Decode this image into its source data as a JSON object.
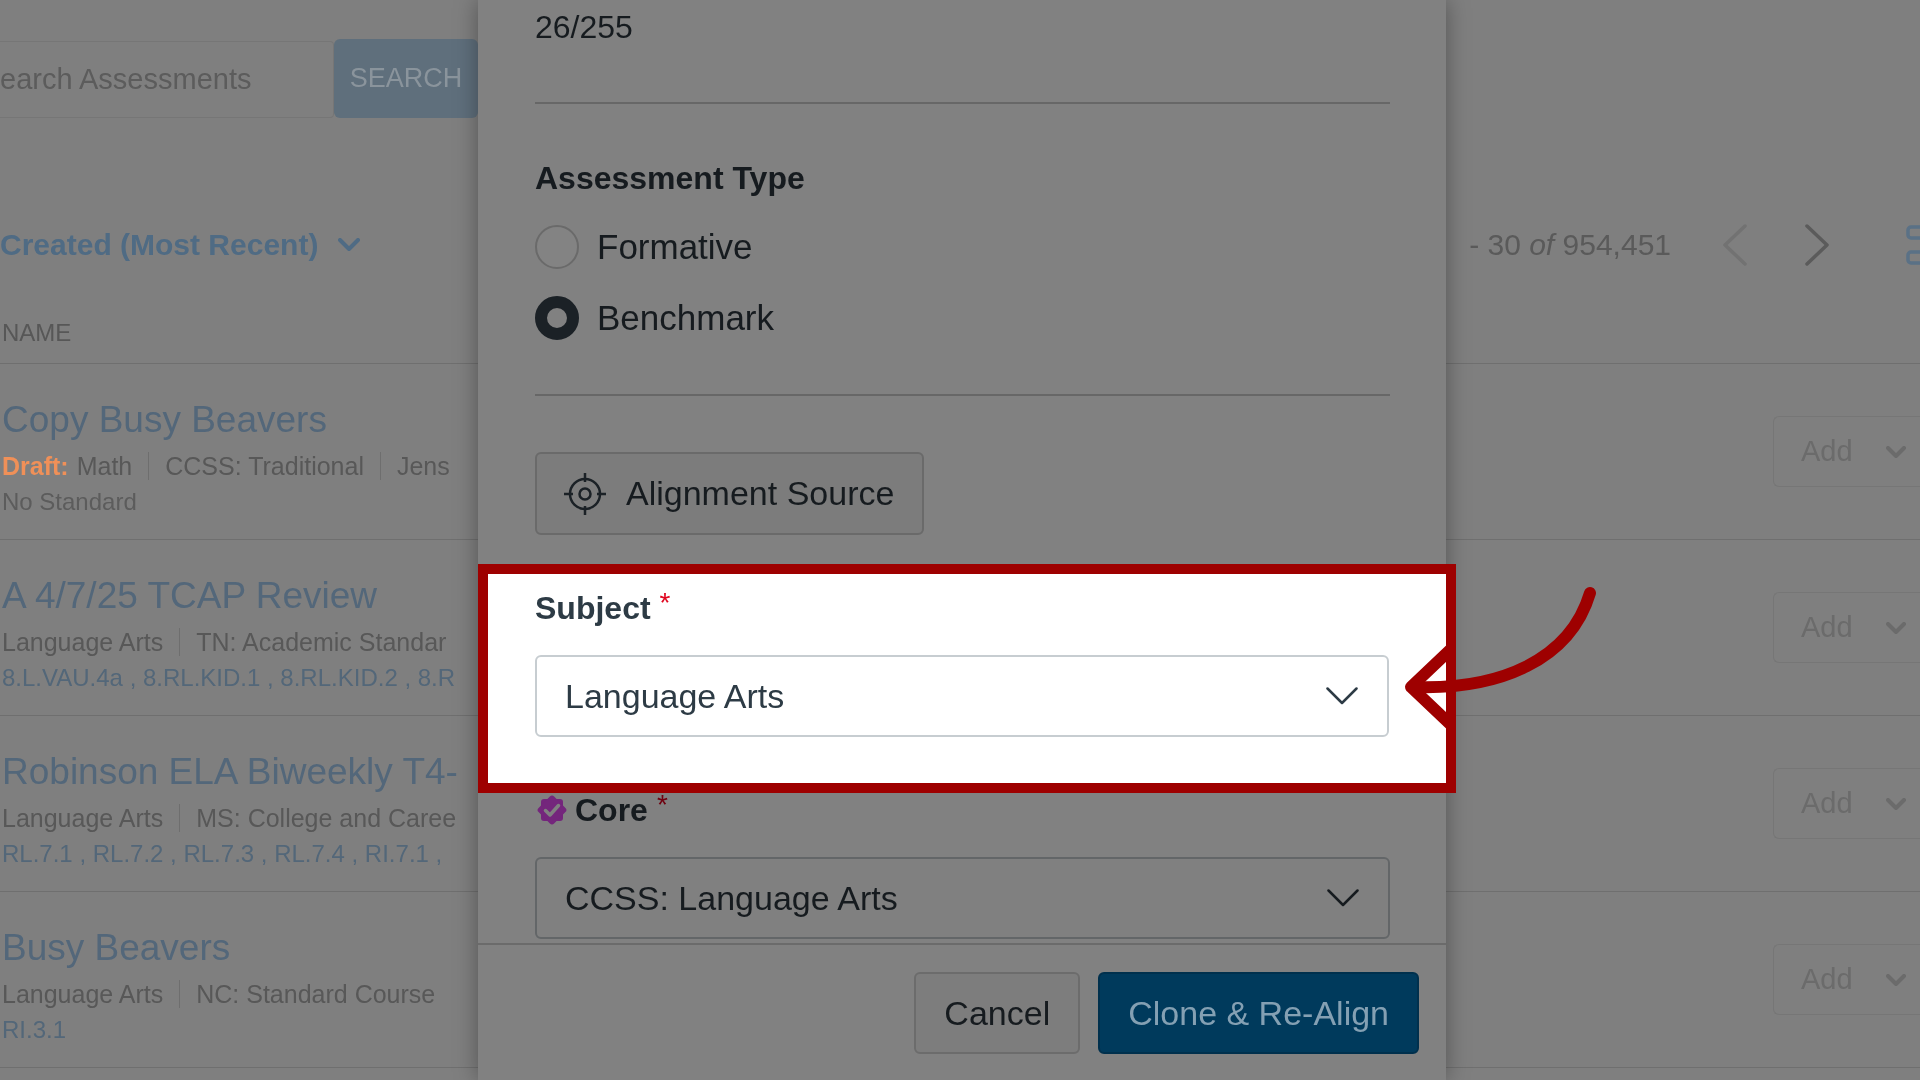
{
  "page": {
    "search": {
      "placeholder": "earch Assessments",
      "button": "SEARCH"
    },
    "sort": {
      "label": "Created (Most Recent)"
    },
    "pagination": {
      "range": "- 30 *of* 954,451",
      "previous": {
        "disabled": true
      },
      "next": {
        "disabled": false
      }
    },
    "table": {
      "columns": [
        "NAME"
      ],
      "rows": [
        {
          "title": "Copy Busy Beavers",
          "status": "Draft:",
          "meta": [
            "Math",
            "CCSS: Traditional",
            "Jens"
          ],
          "standards": {
            "text": "No Standard",
            "linked": false
          },
          "action": "Add"
        },
        {
          "title": "A 4/7/25 TCAP Review",
          "meta": [
            "Language Arts",
            "TN: Academic Standar"
          ],
          "standards": {
            "text": "8.L.VAU.4a , 8.RL.KID.1 , 8.RL.KID.2 , 8.R",
            "linked": true
          },
          "action": "Add"
        },
        {
          "title": "Robinson ELA Biweekly T4-",
          "meta": [
            "Language Arts",
            "MS: College and Caree"
          ],
          "standards": {
            "text": "RL.7.1 , RL.7.2 , RL.7.3 , RL.7.4 , RI.7.1 ,",
            "linked": true
          },
          "action": "Add"
        },
        {
          "title": "Busy Beavers",
          "meta": [
            "Language Arts",
            "NC: Standard Course"
          ],
          "standards": {
            "text": "RI.3.1",
            "linked": true
          },
          "action": "Add"
        }
      ]
    }
  },
  "modal": {
    "counter": "26/255",
    "assessment_type": {
      "label": "Assessment Type",
      "options": [
        {
          "label": "Formative",
          "selected": false
        },
        {
          "label": "Benchmark",
          "selected": true
        }
      ]
    },
    "alignment_button": "Alignment Source",
    "fields": [
      {
        "label": "Subject",
        "required_mark": "*",
        "value": "Language Arts",
        "verified": false,
        "highlighted": true
      },
      {
        "label": "Core",
        "required_mark": "*",
        "value": "CCSS: Language Arts",
        "verified": true,
        "highlighted": false
      }
    ],
    "buttons": [
      {
        "label": "Cancel",
        "kind": "secondary"
      },
      {
        "label": "Clone & Re-Align",
        "kind": "primary"
      }
    ]
  }
}
